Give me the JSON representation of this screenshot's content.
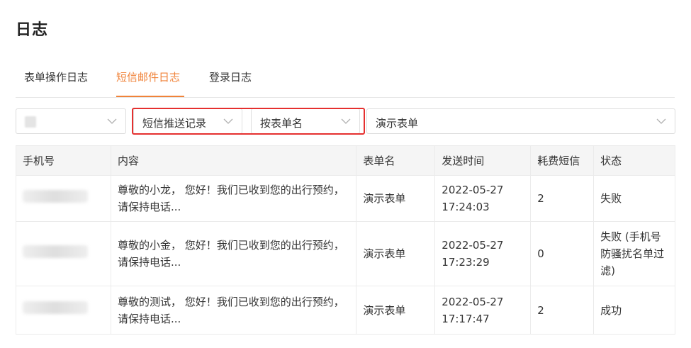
{
  "page": {
    "title": "日志"
  },
  "tabs": [
    {
      "label": "表单操作日志",
      "active": false
    },
    {
      "label": "短信邮件日志",
      "active": true
    },
    {
      "label": "登录日志",
      "active": false
    }
  ],
  "filters": {
    "first": {
      "value": ""
    },
    "record_type": {
      "value": "短信推送记录"
    },
    "group_by": {
      "value": "按表单名"
    },
    "form": {
      "value": "演示表单"
    }
  },
  "table": {
    "headers": [
      "手机号",
      "内容",
      "表单名",
      "发送时间",
      "耗费短信",
      "状态"
    ],
    "rows": [
      {
        "phone": "",
        "content": "尊敬的小龙， 您好！我们已收到您的出行预约，请保持电话...",
        "form": "演示表单",
        "date": "2022-05-27",
        "time": "17:24:03",
        "cost": "2",
        "status": "失败"
      },
      {
        "phone": "",
        "content": "尊敬的小金， 您好！我们已收到您的出行预约，请保持电话...",
        "form": "演示表单",
        "date": "2022-05-27",
        "time": "17:23:29",
        "cost": "0",
        "status": "失败 (手机号防骚扰名单过滤)"
      },
      {
        "phone": "",
        "content": "尊敬的测试， 您好！我们已收到您的出行预约，请保持电话...",
        "form": "演示表单",
        "date": "2022-05-27",
        "time": "17:17:47",
        "cost": "2",
        "status": "成功"
      }
    ]
  },
  "colors": {
    "accent": "#f0833a",
    "highlight": "#e5302f",
    "header_bg": "#f5f5f5"
  }
}
